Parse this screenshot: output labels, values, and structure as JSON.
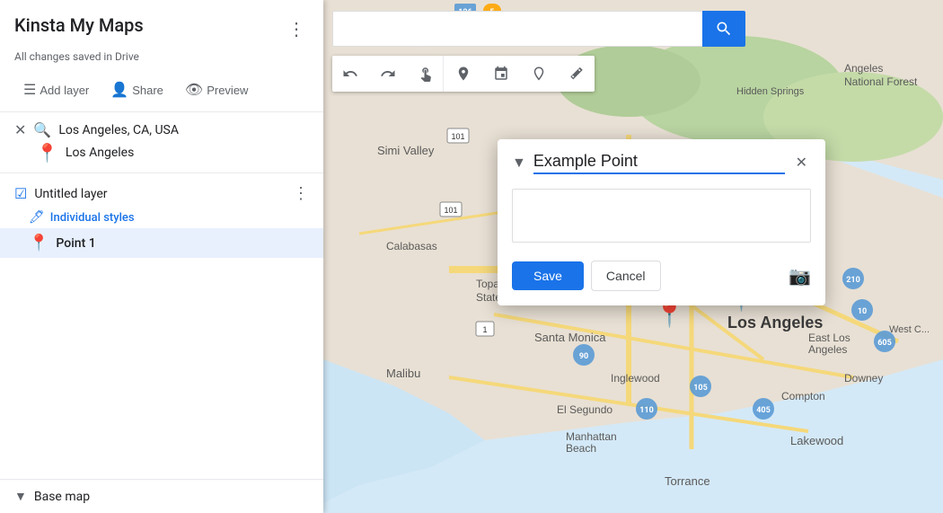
{
  "sidebar": {
    "title": "Kinsta My Maps",
    "more_icon": "⋮",
    "save_status": "All changes saved in Drive",
    "toolbar": {
      "add_layer": "Add layer",
      "share": "Share",
      "preview": "Preview"
    },
    "search": {
      "query": "Los Angeles, CA, USA",
      "location_result": "Los Angeles"
    },
    "layer": {
      "title": "Untitled layer",
      "individual_styles": "Individual styles",
      "point": "Point 1"
    },
    "basemap": {
      "label": "Base map"
    }
  },
  "map": {
    "search_placeholder": "",
    "search_btn_icon": "🔍"
  },
  "tools": {
    "undo": "←",
    "redo": "→",
    "hand": "✋",
    "pin": "📍",
    "shape": "⬡",
    "route": "↕",
    "ruler": "📏"
  },
  "popup": {
    "title": "Example Point",
    "description_placeholder": "",
    "save_label": "Save",
    "cancel_label": "Cancel"
  }
}
